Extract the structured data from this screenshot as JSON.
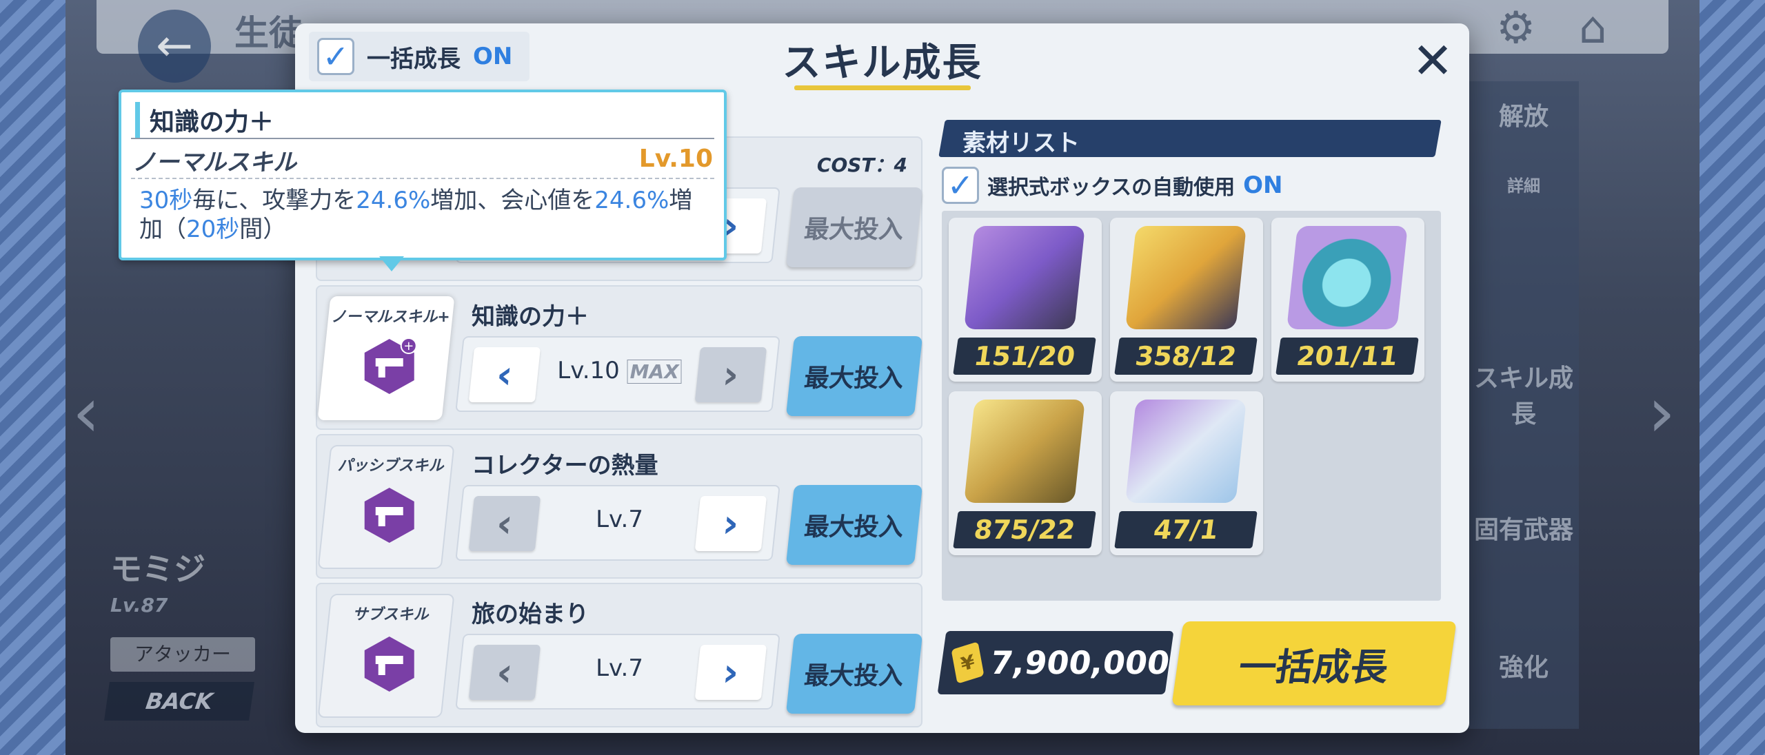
{
  "background": {
    "title": "生徒",
    "character_name": "モミジ",
    "character_level": "Lv.87",
    "role": "アタッカー",
    "back_label": "BACK",
    "side_labels": [
      "解放",
      "詳細",
      "スキル成長",
      "固有武器",
      "強化"
    ]
  },
  "modal": {
    "title": "スキル成長",
    "bulk_toggle": {
      "label": "一括成長",
      "state": "ON"
    }
  },
  "tooltip": {
    "name": "知識の力＋",
    "type": "ノーマルスキル",
    "level": "Lv.10",
    "desc_parts": [
      "30秒",
      "毎に、攻撃力を",
      "24.6%",
      "増加、会心値を",
      "24.6%",
      "増加（",
      "20秒",
      "間）"
    ]
  },
  "skills": {
    "cost_label": "COST：4",
    "rows": [
      {
        "type": "",
        "name": "",
        "level": "",
        "max": "",
        "button": "最大投入"
      },
      {
        "type": "ノーマルスキル+",
        "name": "知識の力＋",
        "level": "Lv.10",
        "max": "MAX",
        "button": "最大投入"
      },
      {
        "type": "パッシブスキル",
        "name": "コレクターの熱量",
        "level": "Lv.7",
        "max": "",
        "button": "最大投入"
      },
      {
        "type": "サブスキル",
        "name": "旅の始まり",
        "level": "Lv.7",
        "max": "",
        "button": "最大投入"
      }
    ]
  },
  "materials": {
    "header": "素材リスト",
    "auto_use": {
      "label": "選択式ボックスの自動使用",
      "state": "ON"
    },
    "items": [
      {
        "icon": "purple-tech-note-icon",
        "count": "151/20"
      },
      {
        "icon": "gold-tech-note-icon",
        "count": "358/12"
      },
      {
        "icon": "blue-artifact-disc-icon",
        "count": "201/11"
      },
      {
        "icon": "gold-book-icon",
        "count": "875/22"
      },
      {
        "icon": "blue-notebook-icon",
        "count": "47/1"
      }
    ]
  },
  "footer": {
    "credits": "7,900,000",
    "bulk_button": "一括成長"
  },
  "colors": {
    "accent_blue": "#3b85e0",
    "tooltip_border": "#61c9e7",
    "level_orange": "#e3992b",
    "button_blue": "#63b6e6",
    "primary_yellow": "#f5d43a",
    "navy": "#26364f"
  }
}
